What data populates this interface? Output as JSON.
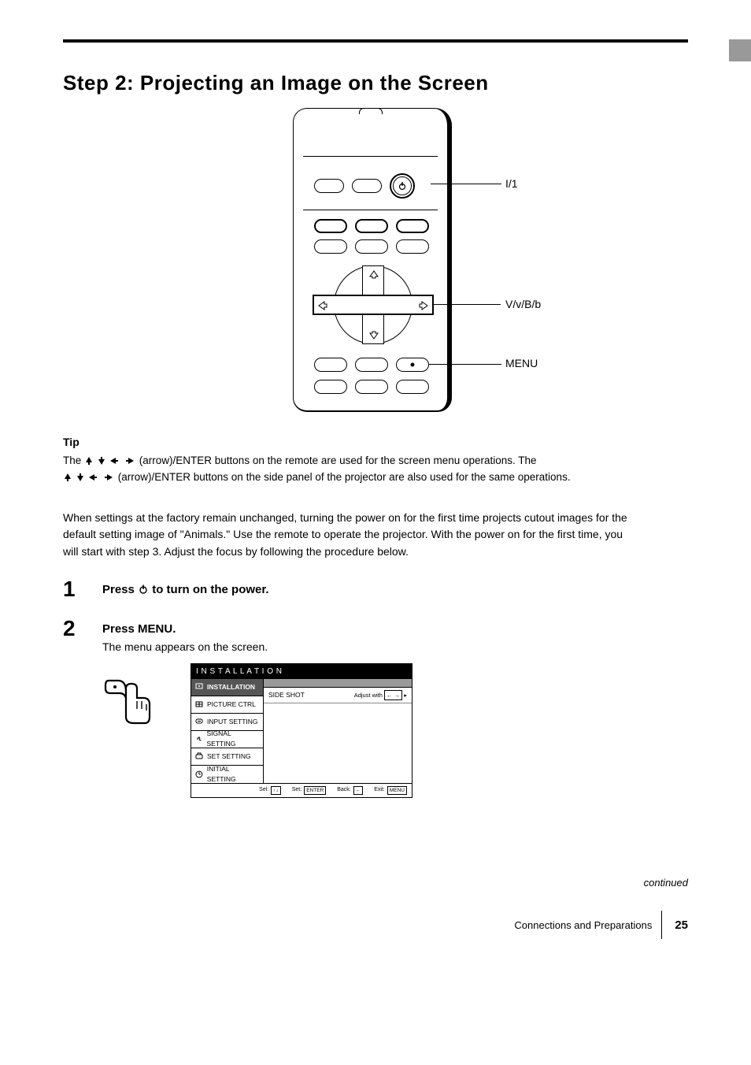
{
  "page": {
    "title": "Step 2: Projecting an Image on the Screen",
    "callouts": {
      "power": "I/1",
      "arrows": "V/v/B/b",
      "menu": "MENU"
    },
    "tip": {
      "head": "Tip",
      "body_pre": "The ",
      "arrows_1": "V/v/B/b",
      "body_mid": " (arrow)/ENTER buttons on the remote are used for the screen menu operations. The ",
      "arrows_2": "M/m/</,",
      "body_post": " (arrow)/ENTER buttons on the side panel of the projector are also used for the same operations."
    },
    "intro": "When settings at the factory remain unchanged, turning the power on for the first time projects cutout images for the default setting image of \"Animals.\" Use the remote to operate the projector. With the power on for the first time, you will start with step 3. Adjust the focus by following the procedure below.",
    "steps": {
      "s1": {
        "lead": "Press I/1 to turn on the power."
      },
      "s2": {
        "lead": "Press MENU.",
        "desc": "The menu appears on the screen."
      }
    },
    "osd": {
      "header": "I N S T A L L A T I O N",
      "sidebar": [
        "INSTALLATION",
        "PICTURE CTRL",
        "INPUT SETTING",
        "SIGNAL SETTING",
        "SET SETTING",
        "INITIAL SETTING"
      ],
      "right_label": "SIDE SHOT",
      "right_value": "Adjust with      .",
      "footer": {
        "sel": "Sel:",
        "set": "Set:",
        "back": "Back:",
        "exit": "Exit:",
        "sel_key": "↑↓",
        "set_key": "ENTER",
        "back_key": "←",
        "exit_key": "MENU"
      }
    },
    "footer": {
      "cont": "continued",
      "section": "Connections and Preparations",
      "page": "25"
    }
  }
}
